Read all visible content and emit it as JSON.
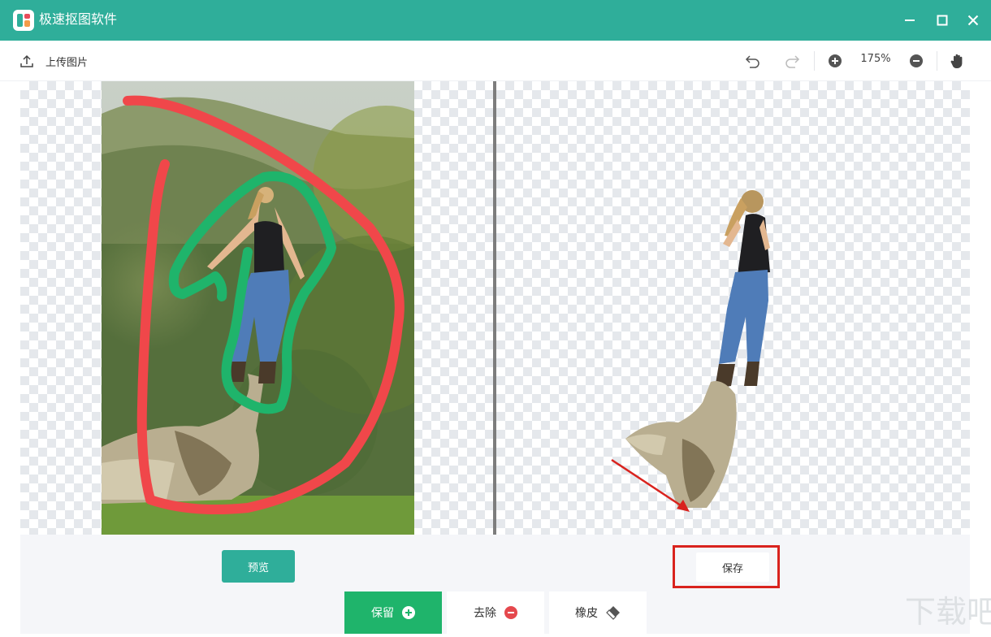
{
  "app": {
    "title": "极速抠图软件"
  },
  "toolbar": {
    "upload_label": "上传图片",
    "zoom": "175%"
  },
  "buttons": {
    "preview": "预览",
    "save": "保存"
  },
  "modes": {
    "keep": "保留",
    "remove": "去除",
    "eraser": "橡皮"
  },
  "watermark": {
    "text": "下载吧"
  },
  "colors": {
    "accent": "#2fae9a",
    "keep_green": "#1fb46b",
    "remove_red": "#e5484d",
    "highlight_red": "#d9231e",
    "stroke_red": "#f0474a",
    "stroke_green": "#1fb46b"
  },
  "icons": {
    "upload": "upload-icon",
    "undo": "undo-icon",
    "redo": "redo-icon",
    "zoom_in": "zoom-in-icon",
    "zoom_out": "zoom-out-icon",
    "pan": "hand-icon",
    "minimize": "minimize-icon",
    "maximize": "maximize-icon",
    "close": "close-icon",
    "keep": "plus-circle-icon",
    "remove": "minus-circle-icon",
    "eraser": "eraser-icon"
  }
}
